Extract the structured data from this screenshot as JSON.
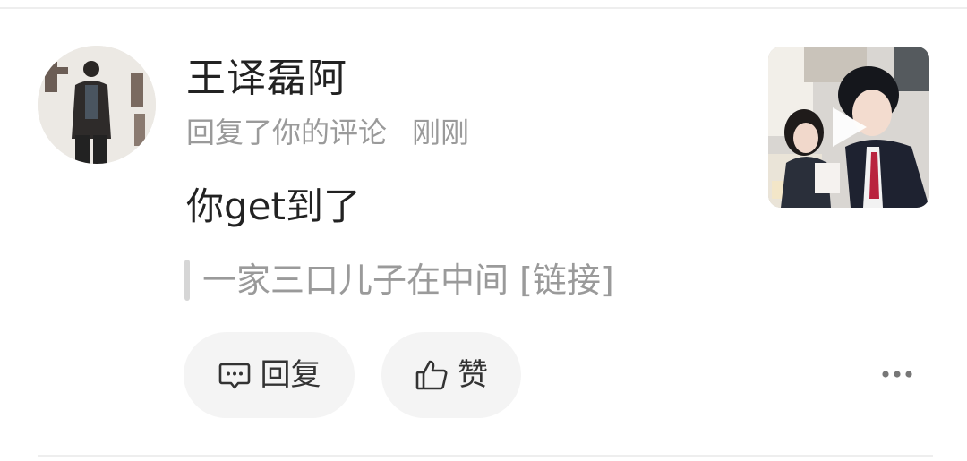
{
  "notification": {
    "user": {
      "name": "王译磊阿",
      "avatar_icon": "user-avatar-photo"
    },
    "action_text": "回复了你的评论",
    "time": "刚刚",
    "comment": "你get到了",
    "quoted_comment": "一家三口儿子在中间 [链接]",
    "thumbnail_icon": "video-thumbnail-with-play-icon"
  },
  "actions": {
    "reply_label": "回复",
    "like_label": "赞",
    "reply_icon": "comment-bubble-icon",
    "like_icon": "thumbs-up-icon",
    "more_icon": "more-dots-icon"
  },
  "colors": {
    "primary_text": "#222222",
    "secondary_text": "#9a9a9a",
    "pill_bg": "#f4f4f4",
    "divider": "#eeeeee"
  }
}
